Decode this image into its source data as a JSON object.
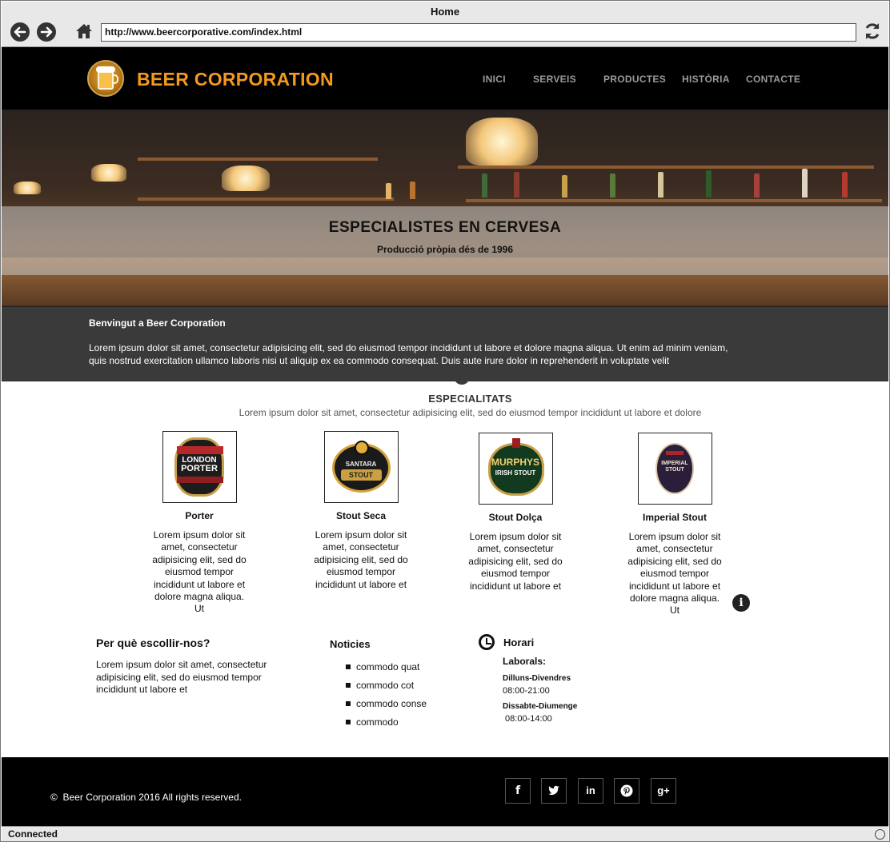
{
  "browser": {
    "window_title": "Home",
    "url": "http://www.beercorporative.com/index.html",
    "status": "Connected"
  },
  "header": {
    "brand": "BEER CORPORATION",
    "menu": [
      "INICI",
      "SERVEIS",
      "PRODUCTES",
      "HISTÒRIA",
      "CONTACTE"
    ]
  },
  "hero": {
    "title": "ESPECIALISTES EN CERVESA",
    "subtitle": "Producció pròpia dés de 1996"
  },
  "welcome": {
    "heading": "Benvingut a Beer Corporation",
    "text": "Lorem ipsum dolor sit amet, consectetur adipisicing elit, sed do eiusmod tempor incididunt ut labore et dolore magna aliqua. Ut enim ad minim veniam, quis nostrud exercitation ullamco laboris nisi ut aliquip ex ea commodo consequat. Duis aute irure dolor in reprehenderit in voluptate velit"
  },
  "specials": {
    "title": "ESPECIALITATS",
    "subtitle": "Lorem ipsum dolor sit amet, consectetur adipisicing elit, sed do eiusmod tempor incididunt ut labore et dolore",
    "items": [
      {
        "name": "Porter",
        "logo_text": [
          "LONDON",
          "PORTER"
        ],
        "desc": "Lorem ipsum dolor sit amet, consectetur adipisicing elit, sed do eiusmod tempor incididunt ut labore et dolore magna aliqua. Ut"
      },
      {
        "name": "Stout Seca",
        "logo_text": [
          "SANTARA",
          "STOUT"
        ],
        "desc": "Lorem ipsum dolor sit amet, consectetur adipisicing elit, sed do eiusmod tempor incididunt ut labore et"
      },
      {
        "name": "Stout Dolça",
        "logo_text": [
          "MURPHYS",
          "IRISH STOUT"
        ],
        "desc": "Lorem ipsum dolor sit amet, consectetur adipisicing elit, sed do eiusmod tempor incididunt ut labore et"
      },
      {
        "name": "Imperial Stout",
        "logo_text": [
          "IMPERIAL",
          "STOUT"
        ],
        "desc": "Lorem ipsum dolor sit amet, consectetur adipisicing elit, sed do eiusmod tempor incididunt ut labore et dolore magna aliqua. Ut"
      }
    ]
  },
  "why": {
    "heading": "Per què escollir-nos?",
    "text": "Lorem ipsum dolor sit amet, consectetur adipisicing elit, sed do eiusmod tempor incididunt ut labore et"
  },
  "news": {
    "heading": "Noticies",
    "items": [
      "commodo quat",
      "commodo cot",
      "commodo conse",
      "commodo"
    ]
  },
  "hours": {
    "heading": "Horari",
    "label": "Laborals:",
    "weekday_label": "Dilluns-Divendres",
    "weekday_time": "08:00-21:00",
    "weekend_label": "Dissabte-Diumenge",
    "weekend_time": " 08:00-14:00"
  },
  "footer": {
    "copyright_symbol": "©",
    "copyright": "Beer Corporation 2016 All rights reserved.",
    "social": [
      "f",
      "twitter-icon",
      "in",
      "pinterest-icon",
      "g+"
    ]
  },
  "colors": {
    "brand": "#f39a1c",
    "header_bg": "#000000",
    "welcome_bg": "#3a3a3a"
  }
}
